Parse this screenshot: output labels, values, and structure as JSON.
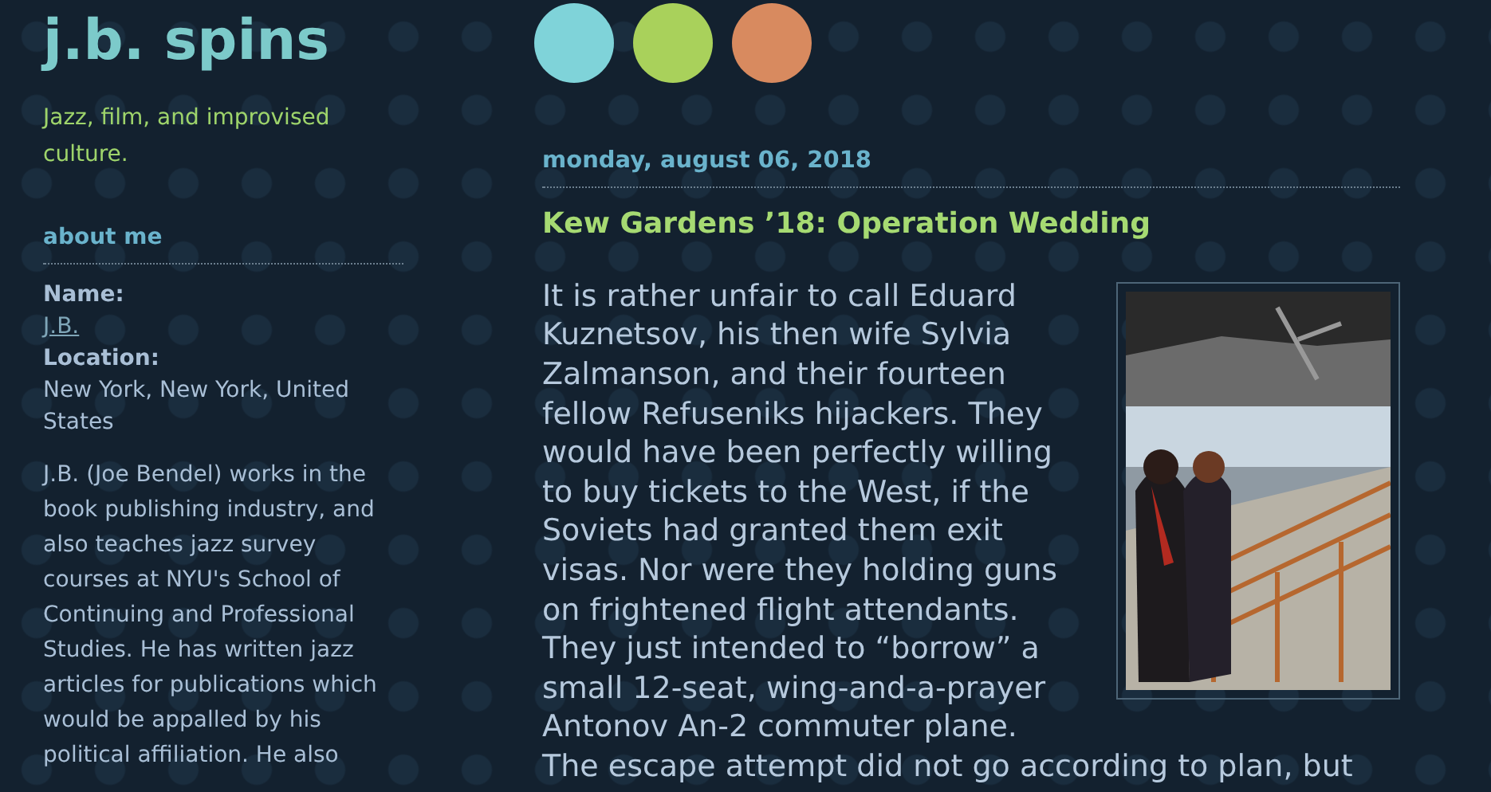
{
  "blog": {
    "title": "j.b. spins",
    "tagline": "Jazz, film, and improvised culture."
  },
  "header_dots": [
    {
      "color": "#7fd3d9"
    },
    {
      "color": "#a9d15b"
    },
    {
      "color": "#d88a5f"
    }
  ],
  "sidebar": {
    "heading": "about me",
    "fields": [
      {
        "label": "Name:",
        "value": "J.B.",
        "kind": "link"
      },
      {
        "label": "Location:",
        "value": "New York, New York, United States",
        "kind": "text"
      }
    ],
    "bio": "J.B. (Joe Bendel) works in the book publishing industry, and also teaches jazz survey courses at NYU's School of Continuing and Professional Studies. He has written jazz articles for publications which would be appalled by his political affiliation. He also"
  },
  "post": {
    "date": "monday, august 06, 2018",
    "title": "Kew Gardens ’18: Operation Wedding",
    "image": {
      "kind": "picture"
    },
    "body": [
      "It is rather unfair to call Eduard Kuznetsov, his then wife Sylvia Zalmanson, and their fourteen fellow Refuseniks hijackers. They would have been perfectly willing to buy tickets to the West, if the Soviets had granted them exit visas. Nor were they holding guns on frightened flight attendants. They just intended to “borrow” a small 12-seat, wing-and-a-prayer Antonov An-2 commuter plane.",
      "The escape attempt did not go according to plan, but"
    ]
  }
}
